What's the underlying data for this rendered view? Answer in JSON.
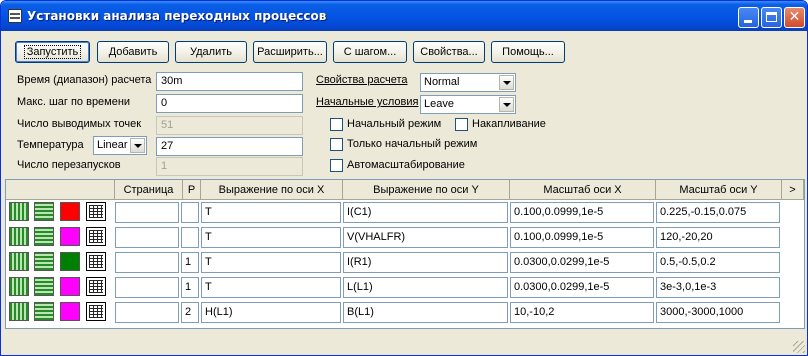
{
  "window": {
    "title": "Установки анализа переходных процессов",
    "colors": {
      "titlebar": "#0554e3",
      "face": "#ece9d8",
      "border": "#7f9db9"
    }
  },
  "title_controls": {
    "minimize": "minimize-icon",
    "maximize": "maximize-icon",
    "close": "✕"
  },
  "toolbar": {
    "run": "Запустить",
    "add": "Добавить",
    "delete": "Удалить",
    "expand": "Расширить...",
    "step": "С шагом...",
    "properties": "Свойства...",
    "help": "Помощь..."
  },
  "params": {
    "time_label": "Время (диапазон) расчета",
    "time_value": "30m",
    "max_step_label": "Макс.  шаг по времени",
    "max_step_value": "0",
    "points_label": "Число выводимых точек",
    "points_value": "51",
    "temp_label": "Температура",
    "temp_mode": "Linear",
    "temp_value": "27",
    "restarts_label": "Число перезапусков",
    "restarts_value": "1"
  },
  "options": {
    "calc_props_label": "Свойства расчета",
    "calc_props_value": "Normal",
    "init_cond_label": "Начальные условия",
    "init_cond_value": "Leave",
    "init_mode": "Начальный режим",
    "accumulate": "Накапливание",
    "only_init": "Только начальный режим",
    "autoscale": "Автомасштабирование"
  },
  "table": {
    "columns": [
      "Страница",
      "P",
      "Выражение по оси X",
      "Выражение по оси Y",
      "Масштаб оси X",
      "Масштаб оси Y",
      ">"
    ],
    "rows": [
      {
        "color": "#ff0000",
        "page": "",
        "p": "",
        "x": "T",
        "y": "I(C1)",
        "xscale": "0.100,0.0999,1e-5",
        "yscale": "0.225,-0.15,0.075"
      },
      {
        "color": "#ff00ff",
        "page": "",
        "p": "",
        "x": "T",
        "y": "V(VHALFR)",
        "xscale": "0.100,0.0999,1e-5",
        "yscale": "120,-20,20"
      },
      {
        "color": "#008000",
        "page": "",
        "p": "1",
        "x": "T",
        "y": "I(R1)",
        "xscale": "0.0300,0.0299,1e-5",
        "yscale": "0.5,-0.5,0.2"
      },
      {
        "color": "#ff00ff",
        "page": "",
        "p": "1",
        "x": "T",
        "y": "L(L1)",
        "xscale": "0.0300,0.0299,1e-5",
        "yscale": "3e-3,0,1e-3"
      },
      {
        "color": "#ff00ff",
        "page": "",
        "p": "2",
        "x": "H(L1)",
        "y": "B(L1)",
        "xscale": "10,-10,2",
        "yscale": "3000,-3000,1000"
      }
    ]
  }
}
